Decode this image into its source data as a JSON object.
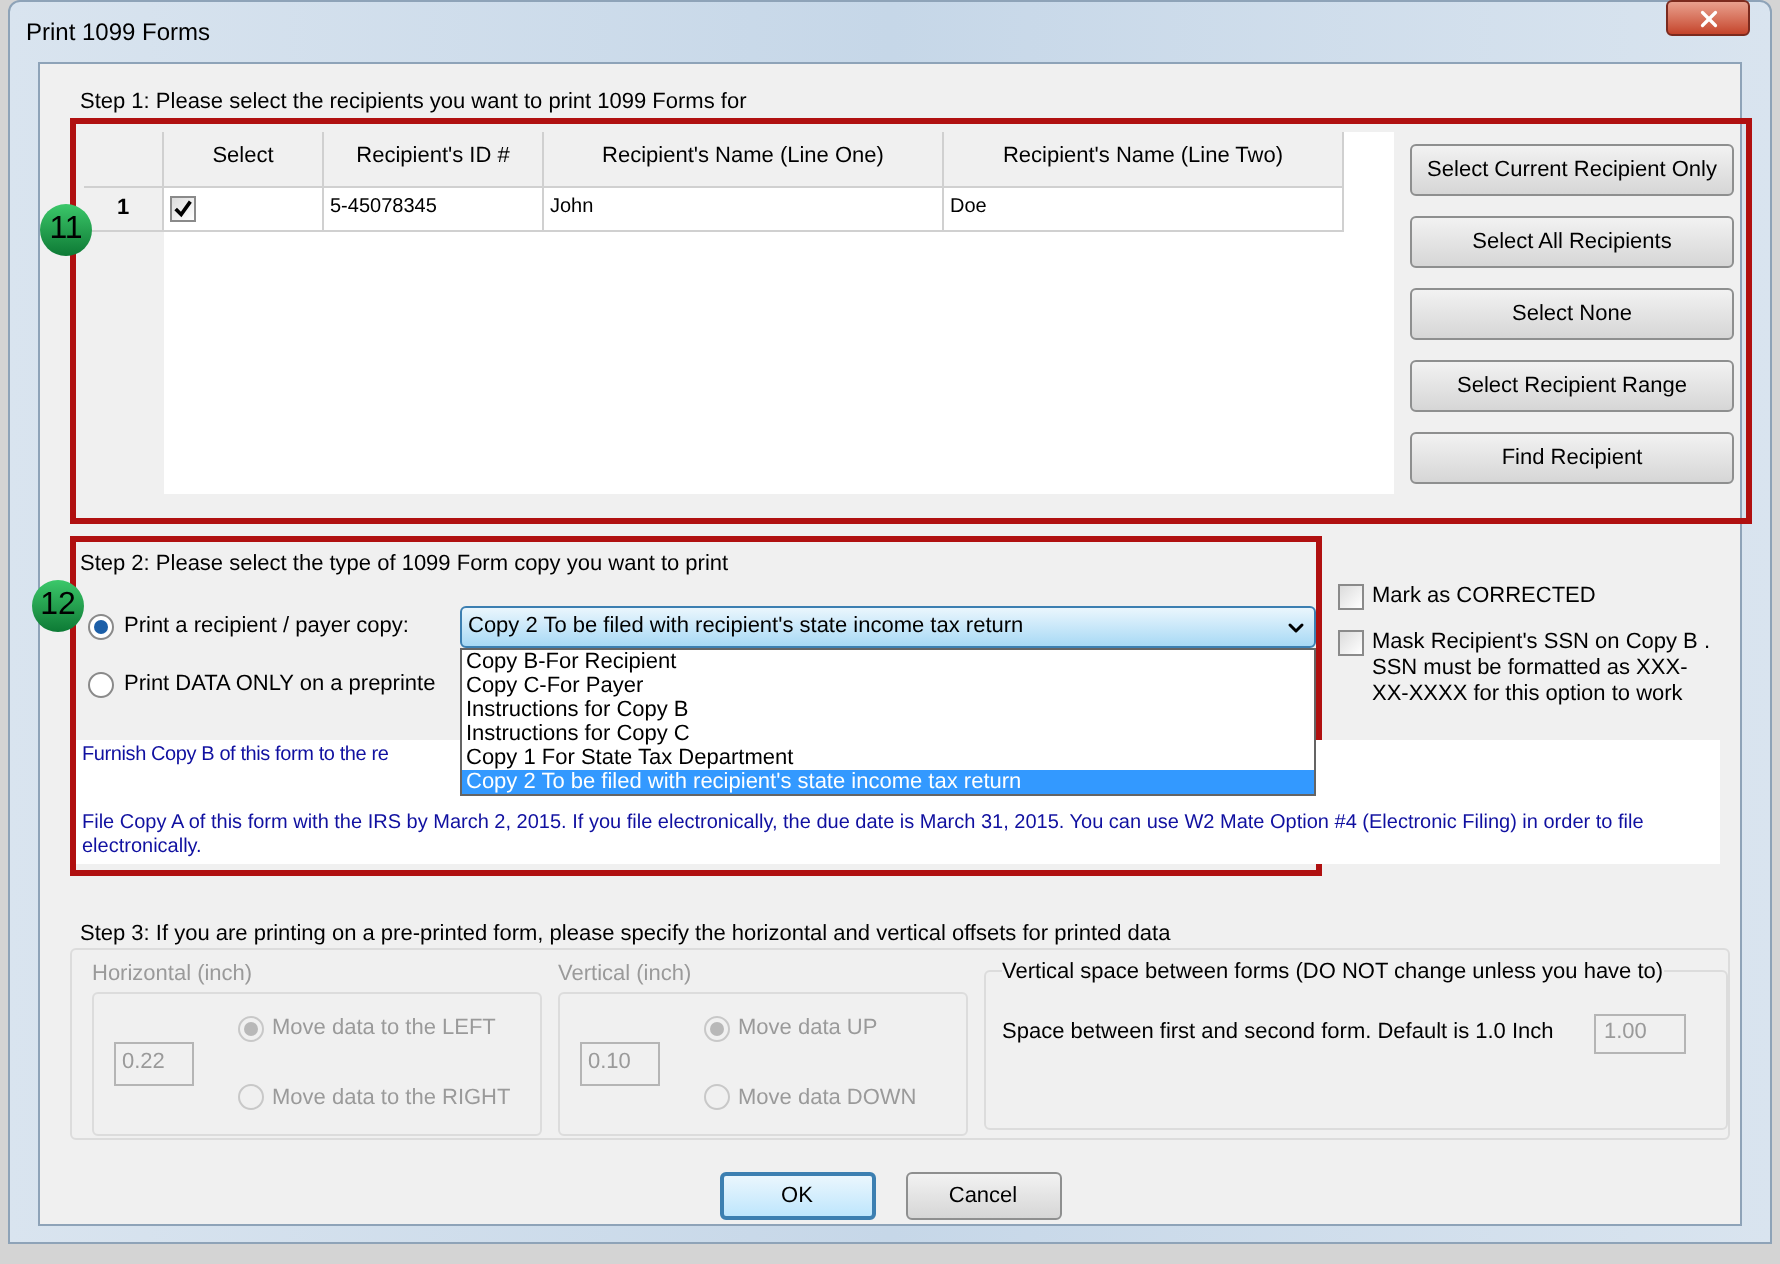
{
  "window": {
    "title": "Print 1099 Forms"
  },
  "step1": {
    "label": "Step 1: Please select the recipients you want to print 1099 Forms for",
    "annotation": "11",
    "table": {
      "columns": [
        "Select",
        "Recipient's ID #",
        "Recipient's Name (Line One)",
        "Recipient's Name (Line Two)"
      ],
      "rows": [
        {
          "number": "1",
          "checked": true,
          "id": "5-45078345",
          "name_line_one": "John",
          "name_line_two": "Doe"
        }
      ]
    },
    "buttons": [
      "Select Current Recipient Only",
      "Select All Recipients",
      "Select None",
      "Select Recipient Range",
      "Find Recipient"
    ]
  },
  "step2": {
    "label": "Step 2: Please select the type of 1099 Form copy you want to print",
    "annotation": "12",
    "options": [
      {
        "label": "Print a recipient / payer copy:",
        "selected": true
      },
      {
        "label": "Print DATA ONLY on a preprinte",
        "selected": false
      }
    ],
    "copy_select": {
      "value": "Copy 2 To be filed with recipient's state income tax return",
      "expanded": true,
      "options": [
        {
          "label": "Copy B-For Recipient",
          "selected": false
        },
        {
          "label": "Copy C-For Payer",
          "selected": false
        },
        {
          "label": "Instructions for Copy B",
          "selected": false
        },
        {
          "label": "Instructions for Copy C",
          "selected": false
        },
        {
          "label": "Copy 1 For State Tax Department",
          "selected": false
        },
        {
          "label": "Copy 2 To be filed with recipient's state income tax return",
          "selected": true
        }
      ]
    },
    "checkboxes": [
      {
        "label": "Mark as CORRECTED",
        "checked": false
      },
      {
        "label": "Mask Recipient's SSN on Copy B . SSN must be formatted as XXX-XX-XXXX for this option to work",
        "checked": false
      }
    ],
    "info": [
      "Furnish Copy B of this form to the re",
      "File Copy A of this form with the IRS by March 2, 2015. If you file electronically, the due date is March 31, 2015. You can use W2 Mate Option #4 (Electronic Filing) in order to file electronically."
    ]
  },
  "step3": {
    "label": "Step 3: If you are printing on a pre-printed form, please specify the horizontal and vertical offsets for printed data",
    "disabled": true,
    "groups": [
      {
        "title": "Horizontal (inch)",
        "value": "0.22",
        "options": [
          {
            "label": "Move data to the LEFT",
            "selected": true
          },
          {
            "label": "Move data to the RIGHT",
            "selected": false
          }
        ]
      },
      {
        "title": "Vertical (inch)",
        "value": "0.10",
        "options": [
          {
            "label": "Move data UP",
            "selected": true
          },
          {
            "label": "Move data DOWN",
            "selected": false
          }
        ]
      }
    ],
    "spacing": {
      "title": "Vertical space between forms (DO NOT change unless you have to)",
      "label": "Space between first and second form. Default is 1.0 Inch",
      "value": "1.00"
    }
  },
  "buttons": [
    {
      "label": "OK",
      "default": true
    },
    {
      "label": "Cancel",
      "default": false
    }
  ]
}
